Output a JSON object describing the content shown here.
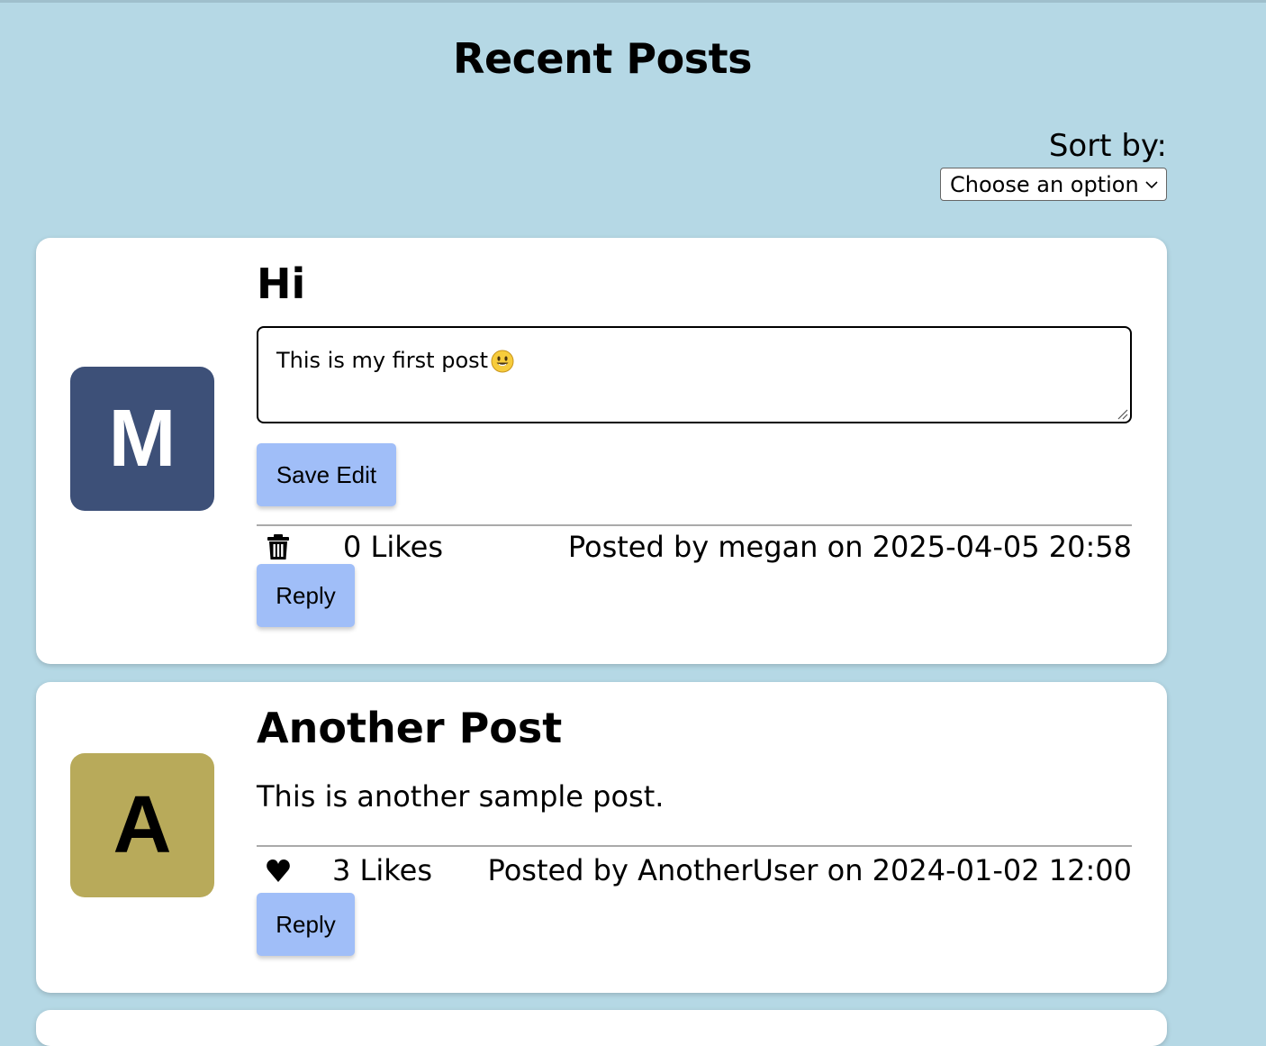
{
  "page": {
    "title": "Recent Posts"
  },
  "sort": {
    "label": "Sort by:",
    "selected": "Choose an option"
  },
  "posts": [
    {
      "avatar_letter": "M",
      "avatar_color": "#3d5078",
      "title": "Hi",
      "edit_value": "This is my first post",
      "edit_emoji": "smiley-icon",
      "save_label": "Save Edit",
      "action_icon": "trash-icon",
      "likes": "0 Likes",
      "posted": "Posted by megan on 2025-04-05 20:58",
      "reply_label": "Reply"
    },
    {
      "avatar_letter": "A",
      "avatar_color": "#b8aa5a",
      "title": "Another Post",
      "body": "This is another sample post.",
      "action_icon": "heart-icon",
      "likes": "3 Likes",
      "posted": "Posted by AnotherUser on 2024-01-02 12:00",
      "reply_label": "Reply"
    }
  ]
}
